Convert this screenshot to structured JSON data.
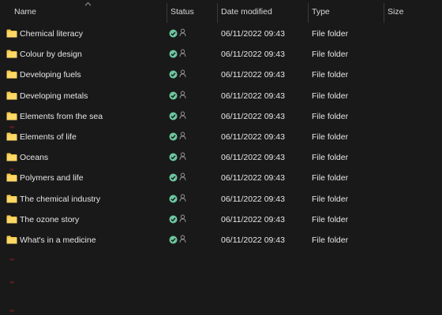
{
  "columns": {
    "name": "Name",
    "status": "Status",
    "date_modified": "Date modified",
    "type": "Type",
    "size": "Size"
  },
  "sort": {
    "column": "name",
    "direction": "ascending",
    "icon": "chevron-up-icon"
  },
  "colors": {
    "background": "#191919",
    "folder": "#f2c94c",
    "sync_check": "#6cc6a0",
    "text": "#e6e6e6"
  },
  "rows": [
    {
      "name": "Chemical literacy",
      "date": "06/11/2022 09:43",
      "type": "File folder",
      "size": ""
    },
    {
      "name": "Colour by design",
      "date": "06/11/2022 09:43",
      "type": "File folder",
      "size": ""
    },
    {
      "name": "Developing fuels",
      "date": "06/11/2022 09:43",
      "type": "File folder",
      "size": ""
    },
    {
      "name": "Developing metals",
      "date": "06/11/2022 09:43",
      "type": "File folder",
      "size": ""
    },
    {
      "name": "Elements from the sea",
      "date": "06/11/2022 09:43",
      "type": "File folder",
      "size": ""
    },
    {
      "name": "Elements of life",
      "date": "06/11/2022 09:43",
      "type": "File folder",
      "size": ""
    },
    {
      "name": "Oceans",
      "date": "06/11/2022 09:43",
      "type": "File folder",
      "size": ""
    },
    {
      "name": "Polymers and life",
      "date": "06/11/2022 09:43",
      "type": "File folder",
      "size": ""
    },
    {
      "name": "The chemical industry",
      "date": "06/11/2022 09:43",
      "type": "File folder",
      "size": ""
    },
    {
      "name": "The ozone story",
      "date": "06/11/2022 09:43",
      "type": "File folder",
      "size": ""
    },
    {
      "name": "What's in a medicine",
      "date": "06/11/2022 09:43",
      "type": "File folder",
      "size": ""
    }
  ]
}
